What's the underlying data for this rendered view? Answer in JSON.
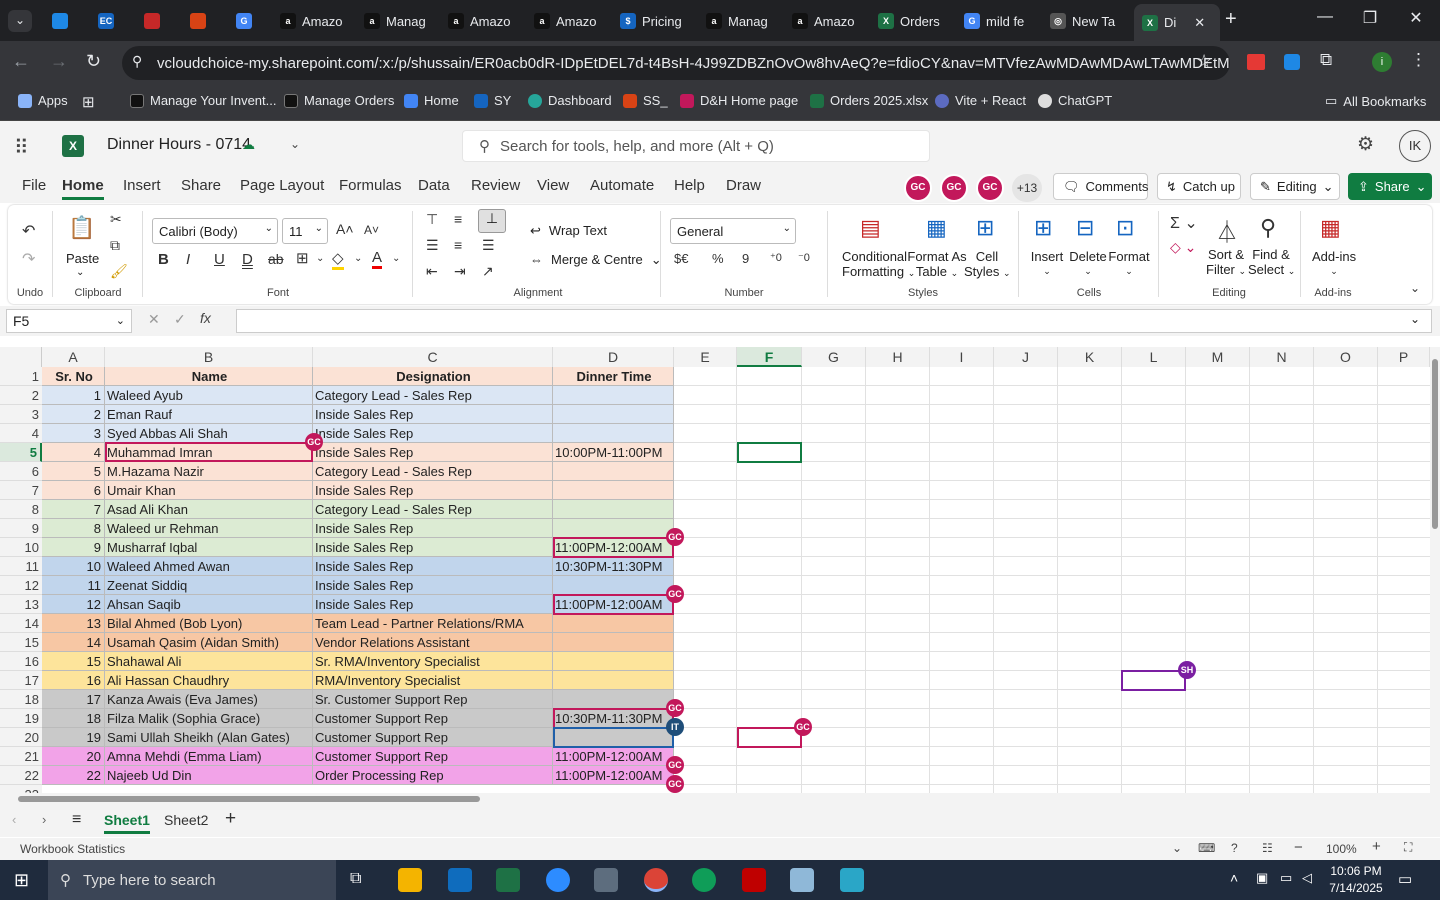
{
  "browser": {
    "tabs": [
      {
        "label": "",
        "color": "#1e88e5"
      },
      {
        "label": "",
        "color": "#1565c0",
        "glyph": "EC"
      },
      {
        "label": "",
        "color": "#c62828"
      },
      {
        "label": "",
        "color": "#d84315"
      },
      {
        "label": "",
        "color": "#4285f4",
        "glyph": "G"
      },
      {
        "label": "Amazo",
        "color": "#111",
        "glyph": "a"
      },
      {
        "label": "Manag",
        "color": "#111",
        "glyph": "a"
      },
      {
        "label": "Amazo",
        "color": "#111",
        "glyph": "a"
      },
      {
        "label": "Amazo",
        "color": "#111",
        "glyph": "a"
      },
      {
        "label": "Pricing",
        "color": "#1565c0",
        "glyph": "$"
      },
      {
        "label": "Manag",
        "color": "#111",
        "glyph": "a"
      },
      {
        "label": "Amazo",
        "color": "#111",
        "glyph": "a"
      },
      {
        "label": "Orders",
        "color": "#1e7145",
        "glyph": "X"
      },
      {
        "label": "mild fe",
        "color": "#4285f4",
        "glyph": "G"
      },
      {
        "label": "New Ta",
        "color": "#555",
        "glyph": "◎"
      },
      {
        "label": "Di",
        "color": "#1e7145",
        "glyph": "X"
      }
    ],
    "url": "vcloudchoice-my.sharepoint.com/:x:/p/shussain/ER0acb0dR-IDpEtDEL7d-t4BsH-4J99ZDBZnOvOw8hvAeQ?e=fdioCY&nav=MTVfezAwMDAwMDAwLTAwMDEtMDAw...",
    "bookmarks": [
      "Apps",
      "Manage Your Invent...",
      "Manage Orders",
      "Home",
      "SY",
      "Dashboard",
      "SS_",
      "D&H Home page",
      "Orders 2025.xlsx",
      "Vite + React",
      "ChatGPT"
    ],
    "all_bookmarks": "All Bookmarks"
  },
  "excel": {
    "doc_title": "Dinner Hours - 0714",
    "search_placeholder": "Search for tools, help, and more (Alt + Q)",
    "user_initials": "IK",
    "menu": [
      "File",
      "Home",
      "Insert",
      "Share",
      "Page Layout",
      "Formulas",
      "Data",
      "Review",
      "View",
      "Automate",
      "Help",
      "Draw"
    ],
    "active_menu": "Home",
    "collab": {
      "avatars": [
        "GC",
        "GC",
        "GC"
      ],
      "more": "+13"
    },
    "comments_label": "Comments",
    "catchup_label": "Catch up",
    "editing_label": "Editing",
    "share_label": "Share",
    "ribbon": {
      "undo_group": "Undo",
      "clipboard_group": "Clipboard",
      "paste": "Paste",
      "font_group": "Font",
      "font_name": "Calibri (Body)",
      "font_size": "11",
      "alignment_group": "Alignment",
      "wrap_text": "Wrap Text",
      "merge_centre": "Merge & Centre",
      "number_group": "Number",
      "number_format": "General",
      "styles_group": "Styles",
      "conditional": [
        "Conditional",
        "Formatting"
      ],
      "format_table": [
        "Format As",
        "Table"
      ],
      "cell_styles": [
        "Cell",
        "Styles"
      ],
      "cells_group": "Cells",
      "insert": "Insert",
      "delete": "Delete",
      "format": "Format",
      "editing_group": "Editing",
      "sort_filter": [
        "Sort &",
        "Filter"
      ],
      "find_select": [
        "Find &",
        "Select"
      ],
      "addins_group": "Add-ins",
      "addins": "Add-ins"
    },
    "name_box": "F5",
    "columns": [
      "A",
      "B",
      "C",
      "D",
      "E",
      "F",
      "G",
      "H",
      "I",
      "J",
      "K",
      "L",
      "M",
      "N",
      "O",
      "P"
    ],
    "header_row": [
      "Sr. No",
      "Name",
      "Designation",
      "Dinner Time"
    ],
    "rows": [
      {
        "n": "1",
        "name": "Waleed Ayub",
        "des": "Category Lead - Sales Rep",
        "time": "",
        "bg": "#dbe6f4"
      },
      {
        "n": "2",
        "name": "Eman Rauf",
        "des": "Inside Sales Rep",
        "time": "",
        "bg": "#dbe6f4"
      },
      {
        "n": "3",
        "name": "Syed Abbas Ali Shah",
        "des": "Inside Sales Rep",
        "time": "",
        "bg": "#dbe6f4"
      },
      {
        "n": "4",
        "name": "Muhammad Imran",
        "des": "Inside Sales Rep",
        "time": "10:00PM-11:00PM",
        "bg": "#fbe2d5"
      },
      {
        "n": "5",
        "name": "M.Hazama Nazir",
        "des": "Category Lead - Sales Rep",
        "time": "",
        "bg": "#fbe2d5"
      },
      {
        "n": "6",
        "name": "Umair Khan",
        "des": "Inside Sales Rep",
        "time": "",
        "bg": "#fbe2d5"
      },
      {
        "n": "7",
        "name": "Asad Ali Khan",
        "des": "Category Lead - Sales Rep",
        "time": "",
        "bg": "#dcebd3"
      },
      {
        "n": "8",
        "name": "Waleed ur Rehman",
        "des": "Inside Sales Rep",
        "time": "",
        "bg": "#dcebd3"
      },
      {
        "n": "9",
        "name": "Musharraf Iqbal",
        "des": "Inside Sales Rep",
        "time": "11:00PM-12:00AM",
        "bg": "#dcebd3"
      },
      {
        "n": "10",
        "name": "Waleed Ahmed Awan",
        "des": "Inside Sales Rep",
        "time": "10:30PM-11:30PM",
        "bg": "#c1d5ec"
      },
      {
        "n": "11",
        "name": "Zeenat Siddiq",
        "des": "Inside Sales Rep",
        "time": "",
        "bg": "#c1d5ec"
      },
      {
        "n": "12",
        "name": "Ahsan Saqib",
        "des": "Inside Sales Rep",
        "time": "11:00PM-12:00AM",
        "bg": "#c1d5ec"
      },
      {
        "n": "13",
        "name": "Bilal Ahmed (Bob Lyon)",
        "des": "Team Lead - Partner Relations/RMA",
        "time": "",
        "bg": "#f7c7a4"
      },
      {
        "n": "14",
        "name": "Usamah Qasim (Aidan Smith)",
        "des": "Vendor Relations Assistant",
        "time": "",
        "bg": "#f7c7a4"
      },
      {
        "n": "15",
        "name": "Shahawal Ali",
        "des": "Sr. RMA/Inventory Specialist",
        "time": "",
        "bg": "#fde49b"
      },
      {
        "n": "16",
        "name": "Ali Hassan Chaudhry",
        "des": "RMA/Inventory Specialist",
        "time": "",
        "bg": "#fde49b"
      },
      {
        "n": "17",
        "name": "Kanza Awais (Eva James)",
        "des": "Sr. Customer Support Rep",
        "time": "",
        "bg": "#c9c9c9"
      },
      {
        "n": "18",
        "name": "Filza Malik (Sophia Grace)",
        "des": "Customer Support Rep",
        "time": "10:30PM-11:30PM",
        "bg": "#c9c9c9"
      },
      {
        "n": "19",
        "name": "Sami Ullah Sheikh (Alan Gates)",
        "des": "Customer Support Rep",
        "time": "",
        "bg": "#c9c9c9"
      },
      {
        "n": "20",
        "name": "Amna Mehdi (Emma Liam)",
        "des": "Customer Support Rep",
        "time": "11:00PM-12:00AM",
        "bg": "#f2a3e8"
      },
      {
        "n": "22",
        "name": "Najeeb Ud Din",
        "des": "Order Processing Rep",
        "time": "11:00PM-12:00AM",
        "bg": "#f2a3e8"
      }
    ],
    "sheets": [
      "Sheet1",
      "Sheet2"
    ],
    "active_sheet": "Sheet1",
    "status_left": "Workbook Statistics",
    "zoom": "100%"
  },
  "taskbar": {
    "search_placeholder": "Type here to search",
    "time": "10:06 PM",
    "date": "7/14/2025"
  }
}
